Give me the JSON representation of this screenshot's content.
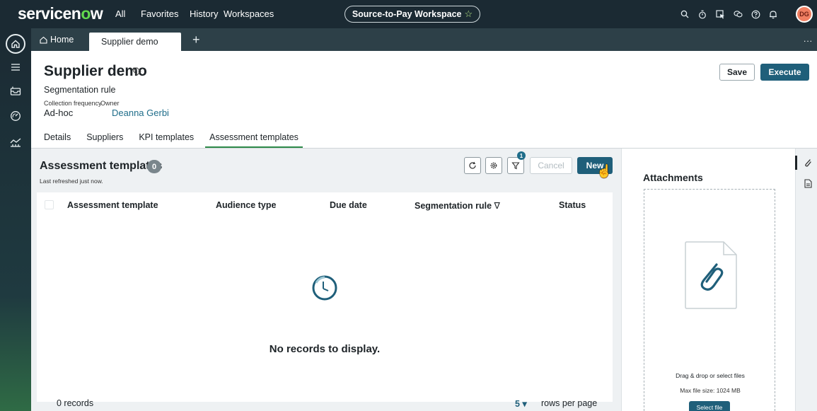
{
  "topnav": {
    "logo_prefix": "servicen",
    "logo_o": "o",
    "logo_suffix": "w",
    "links": [
      "All",
      "Favorites",
      "History",
      "Workspaces"
    ],
    "workspace": "Source-to-Pay Workspace",
    "workspace_star": "☆",
    "avatar_initials": "DG"
  },
  "tabstrip": {
    "home_label": "Home",
    "active_tab": "Supplier demo",
    "add_label": "+",
    "more_label": "..."
  },
  "record": {
    "title": "Supplier demo",
    "subtitle": "Segmentation rule",
    "frequency_label": "Collection frequency",
    "frequency_value": "Ad-hoc",
    "owner_label": "Owner",
    "owner_value": "Deanna Gerbi",
    "save_label": "Save",
    "execute_label": "Execute"
  },
  "record_tabs": [
    {
      "label": "Details",
      "active": false
    },
    {
      "label": "Suppliers",
      "active": false
    },
    {
      "label": "KPI templates",
      "active": false
    },
    {
      "label": "Assessment templates",
      "active": true
    }
  ],
  "list": {
    "title": "Assessment templates",
    "count": "0",
    "refreshed": "Last refreshed just now.",
    "filter_count": "1",
    "cancel_label": "Cancel",
    "new_label": "New",
    "columns": [
      "Assessment template",
      "Audience type",
      "Due date",
      "Segmentation rule",
      "Status"
    ],
    "segmentation_filter_glyph": "∇",
    "empty_message": "No records to display.",
    "records_label": "0 records",
    "rows_per_page_value": "5",
    "rows_per_page_caret": "▾",
    "rows_per_page_label": "rows per page"
  },
  "attachments": {
    "title": "Attachments",
    "drag_text": "Drag & drop or select files",
    "max_size": "Max file size: 1024 MB",
    "select_label": "Select file"
  },
  "colors": {
    "nav_bg": "#1b2a33",
    "primary": "#1f5f7a",
    "accent_green": "#2e8a49",
    "link": "#1f6d8a"
  }
}
